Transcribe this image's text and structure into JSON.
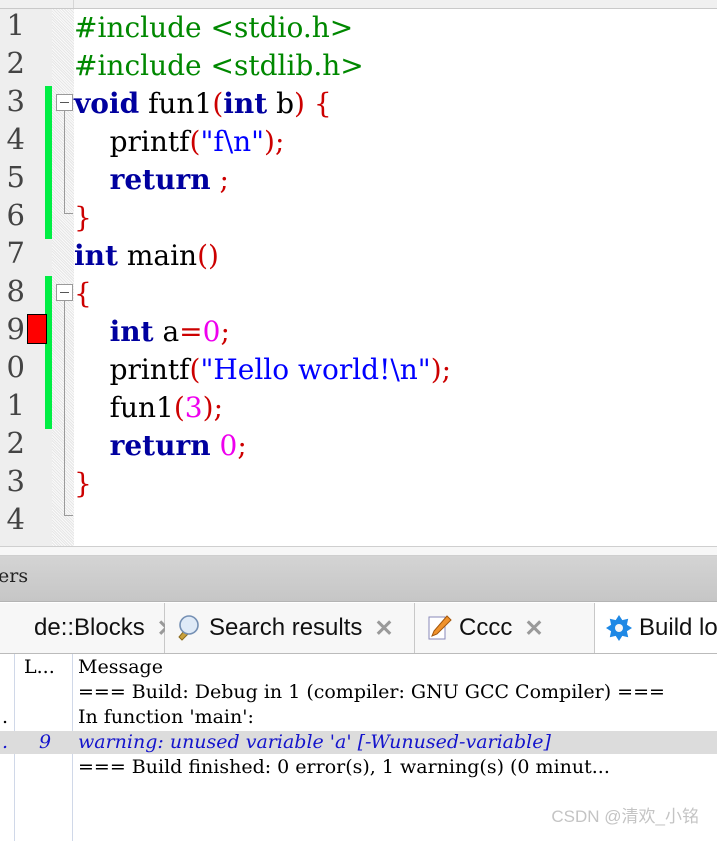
{
  "editor": {
    "line_numbers": [
      "1",
      "2",
      "3",
      "4",
      "5",
      "6",
      "7",
      "8",
      "9",
      "0",
      "1",
      "2",
      "3",
      "4"
    ],
    "lines": [
      {
        "tokens": [
          {
            "t": "#include <stdio.h>",
            "c": "pp"
          }
        ]
      },
      {
        "tokens": [
          {
            "t": "#include <stdlib.h>",
            "c": "pp"
          }
        ]
      },
      {
        "tokens": [
          {
            "t": "void",
            "c": "kw"
          },
          {
            "t": " fun1",
            "c": ""
          },
          {
            "t": "(",
            "c": "op"
          },
          {
            "t": "int",
            "c": "kw"
          },
          {
            "t": " b",
            "c": ""
          },
          {
            "t": ")",
            "c": "op"
          },
          {
            "t": " ",
            "c": ""
          },
          {
            "t": "{",
            "c": "brc"
          }
        ]
      },
      {
        "tokens": [
          {
            "t": "    printf",
            "c": ""
          },
          {
            "t": "(",
            "c": "op"
          },
          {
            "t": "\"f\\n\"",
            "c": "str"
          },
          {
            "t": ")",
            "c": "op"
          },
          {
            "t": ";",
            "c": "op"
          }
        ]
      },
      {
        "tokens": [
          {
            "t": "    ",
            "c": ""
          },
          {
            "t": "return",
            "c": "kw"
          },
          {
            "t": " ",
            "c": ""
          },
          {
            "t": ";",
            "c": "op"
          }
        ]
      },
      {
        "tokens": [
          {
            "t": "}",
            "c": "brc"
          }
        ]
      },
      {
        "tokens": [
          {
            "t": "int",
            "c": "kw"
          },
          {
            "t": " main",
            "c": ""
          },
          {
            "t": "()",
            "c": "op"
          }
        ]
      },
      {
        "tokens": [
          {
            "t": "{",
            "c": "brc"
          }
        ]
      },
      {
        "tokens": [
          {
            "t": "    ",
            "c": ""
          },
          {
            "t": "int",
            "c": "kw"
          },
          {
            "t": " a",
            "c": ""
          },
          {
            "t": "=",
            "c": "op"
          },
          {
            "t": "0",
            "c": "num"
          },
          {
            "t": ";",
            "c": "op"
          }
        ]
      },
      {
        "tokens": [
          {
            "t": "    printf",
            "c": ""
          },
          {
            "t": "(",
            "c": "op"
          },
          {
            "t": "\"Hello world!\\n\"",
            "c": "str"
          },
          {
            "t": ")",
            "c": "op"
          },
          {
            "t": ";",
            "c": "op"
          }
        ]
      },
      {
        "tokens": [
          {
            "t": "    fun1",
            "c": ""
          },
          {
            "t": "(",
            "c": "op"
          },
          {
            "t": "3",
            "c": "num"
          },
          {
            "t": ")",
            "c": "op"
          },
          {
            "t": ";",
            "c": "op"
          }
        ]
      },
      {
        "tokens": [
          {
            "t": "    ",
            "c": ""
          },
          {
            "t": "return",
            "c": "kw"
          },
          {
            "t": " ",
            "c": ""
          },
          {
            "t": "0",
            "c": "num"
          },
          {
            "t": ";",
            "c": "op"
          }
        ]
      },
      {
        "tokens": [
          {
            "t": "}",
            "c": "brc"
          }
        ]
      },
      {
        "tokens": []
      }
    ],
    "breakpoint_line": 9,
    "colors": {
      "changebar": "#00ee44",
      "breakpoint": "#ff0000",
      "keyword": "#00009f",
      "preprocessor": "#008800",
      "string": "#0000ff",
      "number": "#ee00ee",
      "operator": "#cc0000"
    }
  },
  "panel": {
    "title": "ers"
  },
  "tabs": [
    {
      "label": "de::Blocks",
      "icon": "none",
      "close": "✕",
      "active": false
    },
    {
      "label": "Search results",
      "icon": "magnifier-icon",
      "close": "✕",
      "active": false
    },
    {
      "label": "Cccc",
      "icon": "pencil-page-icon",
      "close": "✕",
      "active": false
    },
    {
      "label": "Build log",
      "icon": "gear-icon",
      "close": "",
      "active": true
    }
  ],
  "log": {
    "headers": {
      "file": "",
      "line": "L...",
      "message": "Message"
    },
    "rows": [
      {
        "file": "",
        "line": "",
        "message": "=== Build: Debug in 1 (compiler: GNU GCC Compiler) ===",
        "kind": "normal"
      },
      {
        "file": ".",
        "line": "",
        "message": "In function 'main':",
        "kind": "normal"
      },
      {
        "file": ".",
        "line": "9",
        "message": "warning: unused variable 'a' [-Wunused-variable]",
        "kind": "warning"
      },
      {
        "file": "",
        "line": "",
        "message": "=== Build finished: 0 error(s), 1 warning(s) (0 minut...",
        "kind": "normal"
      }
    ]
  },
  "watermark": {
    "text": "CSDN @清欢_小铭"
  }
}
